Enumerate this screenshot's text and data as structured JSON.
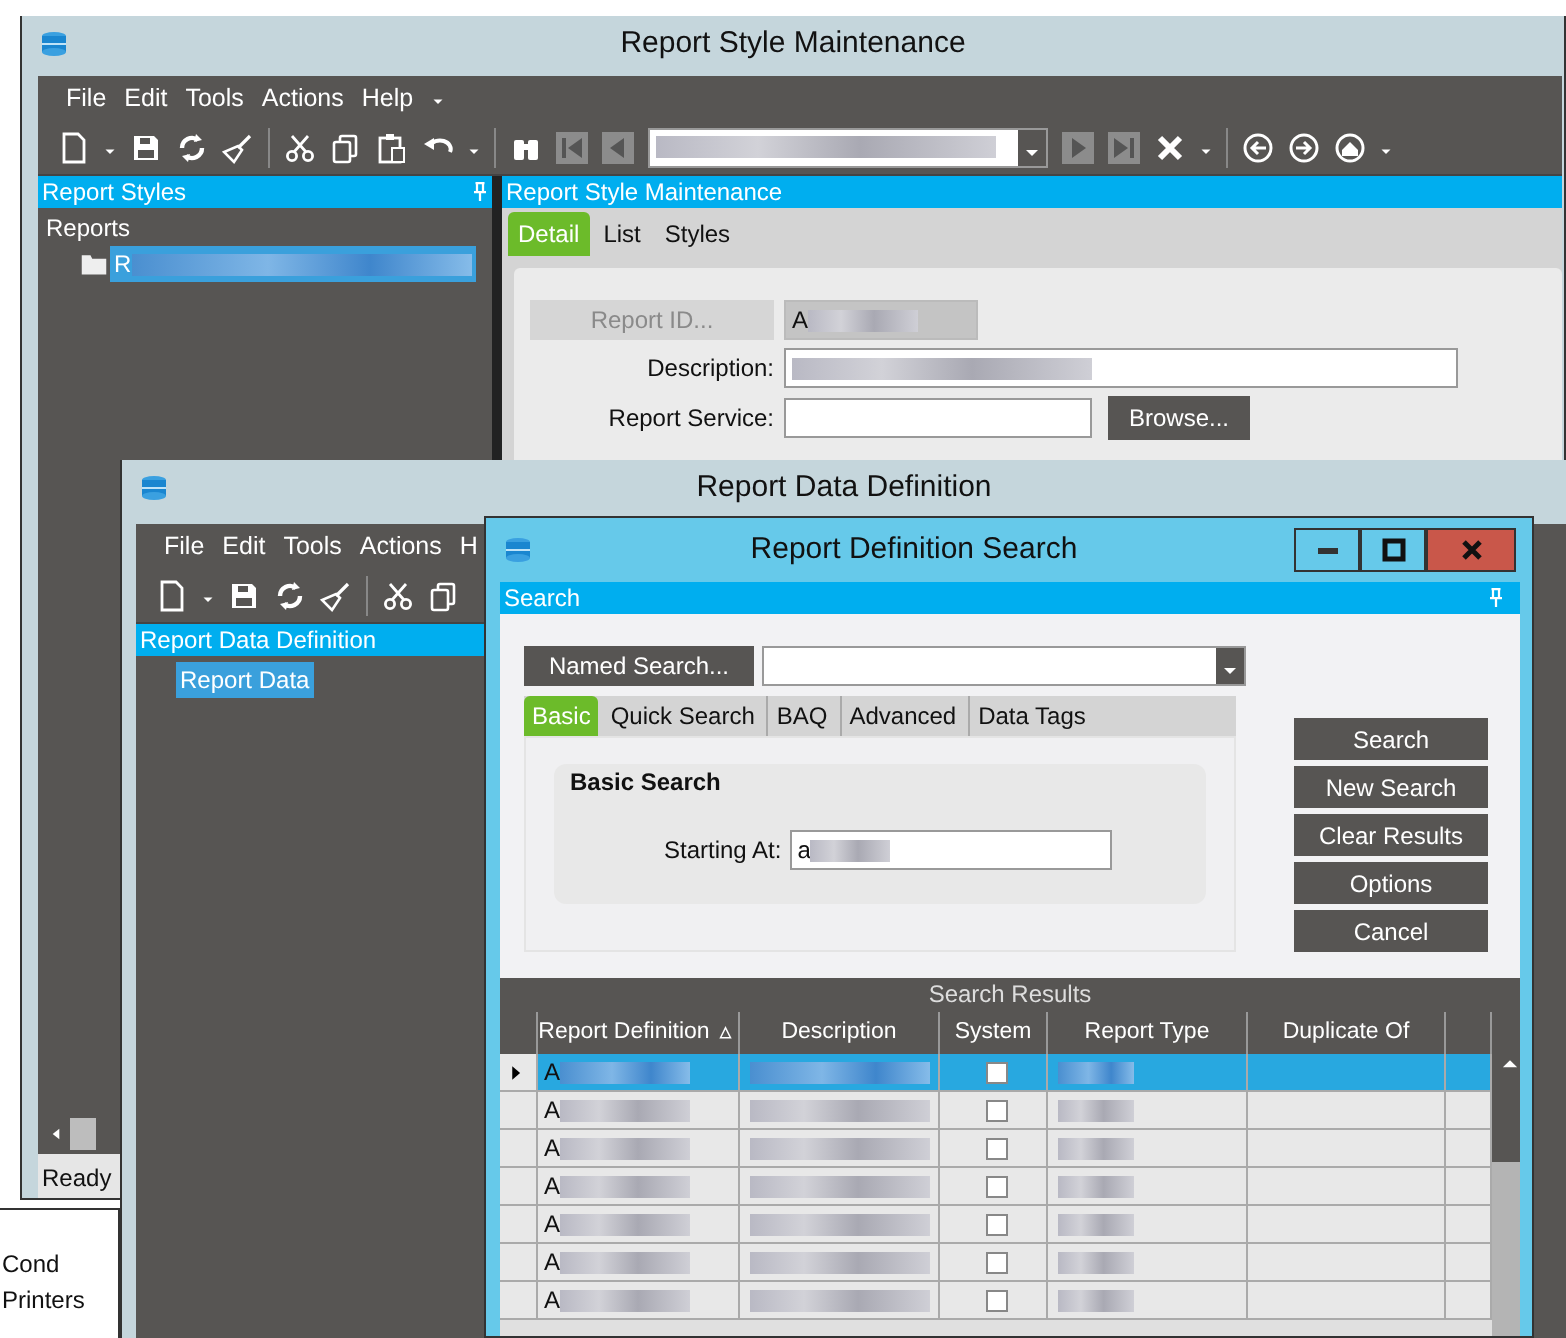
{
  "style_window": {
    "title": "Report Style Maintenance",
    "menu": [
      "File",
      "Edit",
      "Tools",
      "Actions",
      "Help"
    ],
    "left_panel": {
      "title": "Report Styles",
      "tree": [
        {
          "label": "Reports",
          "children": [
            {
              "label": "R",
              "selected": true
            }
          ]
        }
      ]
    },
    "main_panel": {
      "title": "Report Style Maintenance",
      "tabs": [
        {
          "label": "Detail",
          "selected": true
        },
        {
          "label": "List",
          "selected": false
        },
        {
          "label": "Styles",
          "selected": false
        }
      ],
      "report_id": {
        "button": "Report ID...",
        "disabled": true,
        "value": "A"
      },
      "description": {
        "label": "Description:"
      },
      "report_service": {
        "label": "Report Service:",
        "button": "Browse..."
      }
    },
    "status": "Ready"
  },
  "background_window": {
    "items": [
      "Cond",
      "Printers"
    ]
  },
  "data_window": {
    "title": "Report Data Definition",
    "menu": [
      "File",
      "Edit",
      "Tools",
      "Actions",
      "H"
    ],
    "panel_title": "Report Data Definition",
    "tree": [
      {
        "label": "Report Data",
        "selected": true
      }
    ]
  },
  "search_dialog": {
    "title": "Report Definition Search",
    "panel_title": "Search",
    "named_search_button": "Named Search...",
    "tabs": [
      {
        "label": "Basic",
        "selected": true
      },
      {
        "label": "Quick Search",
        "selected": false
      },
      {
        "label": "BAQ",
        "selected": false
      },
      {
        "label": "Advanced",
        "selected": false
      },
      {
        "label": "Data Tags",
        "selected": false
      }
    ],
    "group_title": "Basic Search",
    "starting_at": {
      "label": "Starting At:",
      "value": "a"
    },
    "buttons": [
      "Search",
      "New Search",
      "Clear Results",
      "Options",
      "Cancel"
    ],
    "results": {
      "title": "Search Results",
      "columns": [
        {
          "label": "Report Definition",
          "sorted": true
        },
        {
          "label": "Description",
          "sorted": false
        },
        {
          "label": "System",
          "sorted": false
        },
        {
          "label": "Report Type",
          "sorted": false
        },
        {
          "label": "Duplicate Of",
          "sorted": false
        }
      ],
      "rows": [
        {
          "report_definition": "A",
          "system": false,
          "selected": true
        },
        {
          "report_definition": "A",
          "system": false,
          "selected": false
        },
        {
          "report_definition": "A",
          "system": false,
          "selected": false
        },
        {
          "report_definition": "A",
          "system": false,
          "selected": false
        },
        {
          "report_definition": "A",
          "system": false,
          "selected": false
        },
        {
          "report_definition": "A",
          "system": false,
          "selected": false
        },
        {
          "report_definition": "A",
          "system": false,
          "selected": false
        }
      ]
    }
  }
}
